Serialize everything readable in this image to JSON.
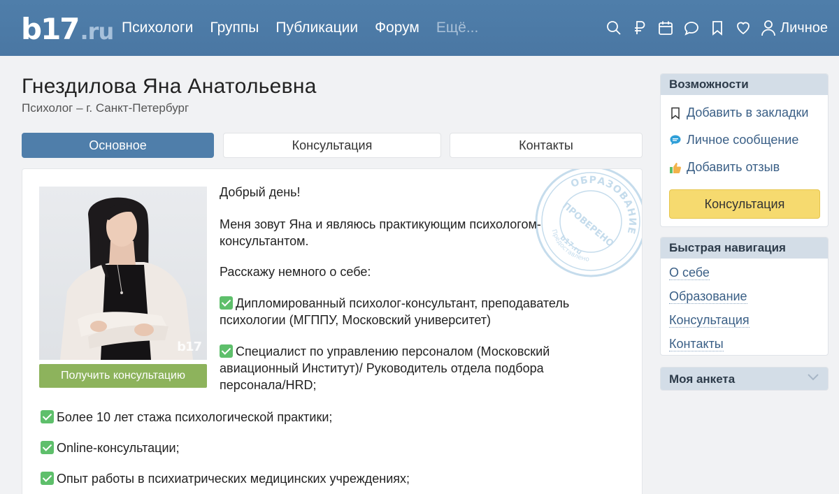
{
  "header": {
    "logo_main": "b17",
    "logo_suffix": ".ru",
    "nav": [
      "Психологи",
      "Группы",
      "Публикации",
      "Форум",
      "Ещё..."
    ],
    "profile_label": "Личное"
  },
  "profile": {
    "name": "Гнездилова Яна Анатольевна",
    "subtitle": "Психолог – г. Санкт-Петербург"
  },
  "tabs": [
    {
      "label": "Основное",
      "active": true
    },
    {
      "label": "Консультация",
      "active": false
    },
    {
      "label": "Контакты",
      "active": false
    }
  ],
  "card": {
    "photo_watermark": "b17",
    "cta": "Получить консультацию",
    "stamp": {
      "top": "ОБРАЗОВАНИЕ",
      "bottom": "ПРОВЕРЕНО",
      "left": "Предоставлено",
      "brand": "b17.ru"
    },
    "greeting": "Добрый день!",
    "intro": "Меня зовут Яна и являюсь практикующим психологом-консультантом.",
    "about": "Расскажу немного о себе:",
    "items": [
      "Дипломированный психолог-консультант, преподаватель психологии (МГППУ, Московский университет)",
      "Специалист по управлению персоналом (Московский авиационный Институт)/ Руководитель отдела подбора персонала/HRD;",
      "Более 10 лет стажа психологической практики;",
      "Online-консультации;",
      "Опыт работы в психиатрических медицинских учреждениях;"
    ]
  },
  "sidebar": {
    "features_title": "Возможности",
    "bookmark": "Добавить в закладки",
    "message": "Личное сообщение",
    "review": "Добавить отзыв",
    "consult_button": "Консультация",
    "quicknav_title": "Быстрая навигация",
    "quicknav": [
      "О себе",
      "Образование",
      "Консультация",
      "Контакты"
    ],
    "my_profile_title": "Моя анкета"
  },
  "colors": {
    "header": "#4f7eaa",
    "green_button": "#8db35c",
    "yellow_button": "#f6da6f",
    "link": "#3a5f86"
  }
}
